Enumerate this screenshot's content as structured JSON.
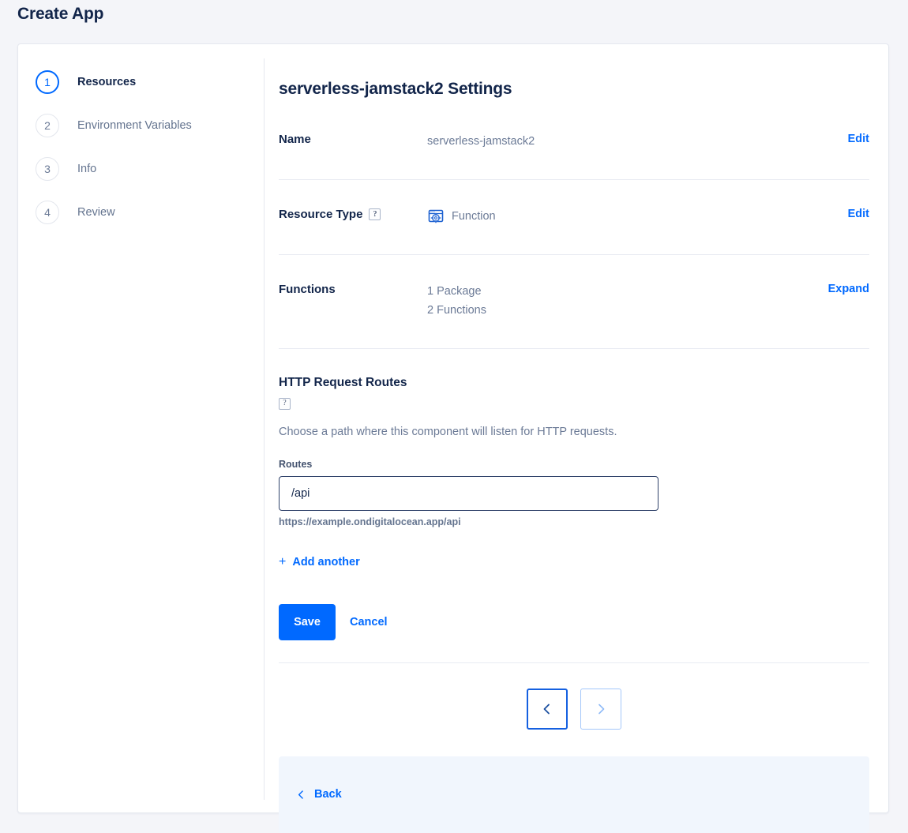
{
  "page": {
    "title": "Create App"
  },
  "stepper": {
    "steps": [
      {
        "number": "1",
        "label": "Resources",
        "active": true
      },
      {
        "number": "2",
        "label": "Environment Variables",
        "active": false
      },
      {
        "number": "3",
        "label": "Info",
        "active": false
      },
      {
        "number": "4",
        "label": "Review",
        "active": false
      }
    ]
  },
  "panel": {
    "title": "serverless-jamstack2 Settings",
    "rows": {
      "name": {
        "label": "Name",
        "value": "serverless-jamstack2",
        "action": "Edit"
      },
      "resource_type": {
        "label": "Resource Type",
        "help": "?",
        "icon": "function-icon",
        "value": "Function",
        "action": "Edit"
      },
      "functions": {
        "label": "Functions",
        "value_line_1": "1 Package",
        "value_line_2": "2 Functions",
        "action": "Expand"
      }
    },
    "routes": {
      "title": "HTTP Request Routes",
      "help": "?",
      "description": "Choose a path where this component will listen for HTTP requests.",
      "field_label": "Routes",
      "value": "/api",
      "placeholder": "/api",
      "hint": "https://example.ondigitalocean.app/api",
      "add_another": "Add another",
      "add_plus": "+"
    },
    "actions": {
      "save": "Save",
      "cancel": "Cancel"
    },
    "pager": {
      "prev_icon": "chevron-left-icon",
      "next_icon": "chevron-right-icon",
      "prev_enabled": true,
      "next_enabled": false
    },
    "footer": {
      "back": "Back",
      "back_icon": "chevron-left-icon"
    }
  },
  "colors": {
    "accent": "#0069ff",
    "title": "#12254a",
    "muted": "#6b7a96",
    "background": "#f4f5f9",
    "footer_bg": "#f1f6fd"
  }
}
